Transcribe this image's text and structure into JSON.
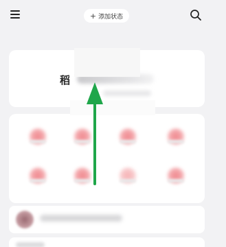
{
  "topbar": {
    "status_plus": "+",
    "status_label": "添加状态",
    "menu_icon": "hamburger-menu-icon",
    "search_icon": "search-icon"
  },
  "profile": {
    "name_char": "稻"
  },
  "grid": {
    "items": [
      {
        "icon": "app-icon-1"
      },
      {
        "icon": "app-icon-2"
      },
      {
        "icon": "app-icon-3"
      },
      {
        "icon": "app-icon-4"
      },
      {
        "icon": "app-icon-5"
      },
      {
        "icon": "app-icon-6"
      },
      {
        "icon": "app-icon-7"
      },
      {
        "icon": "app-icon-8"
      }
    ]
  },
  "annotation": {
    "arrow_color": "#1fa64a"
  }
}
